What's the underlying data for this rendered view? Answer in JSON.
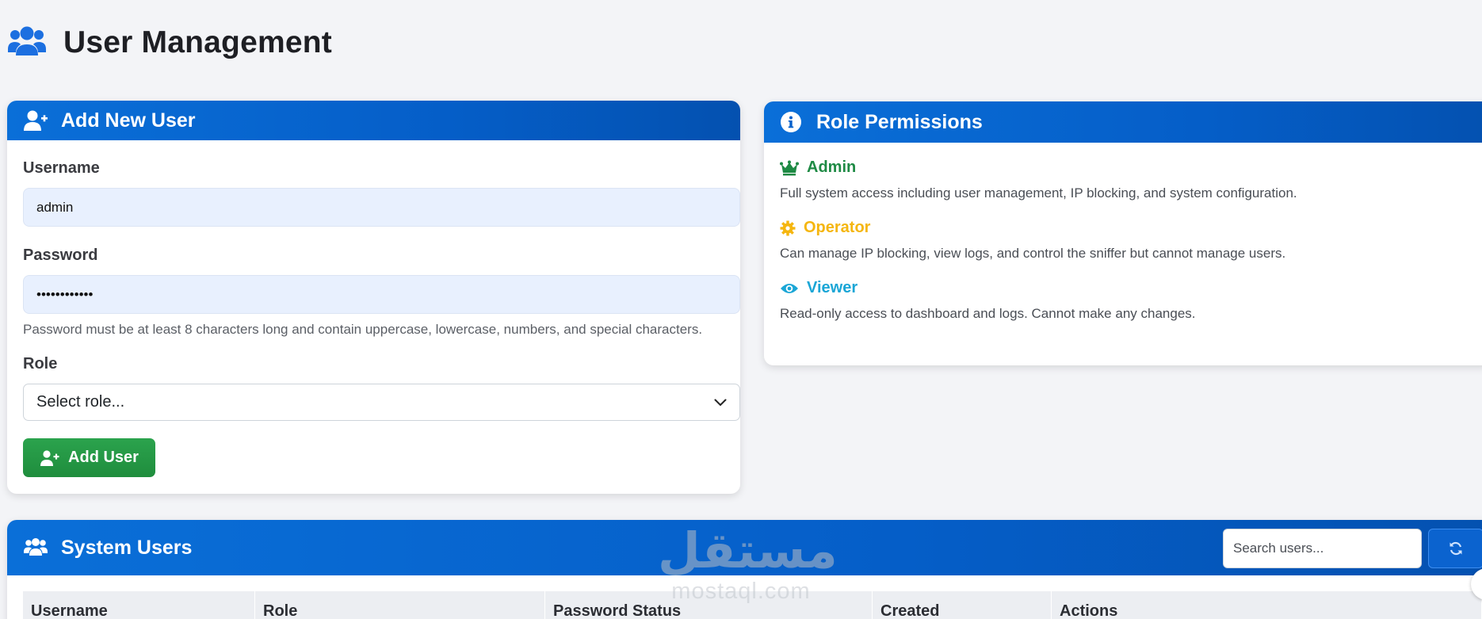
{
  "page": {
    "title": "User Management",
    "accent_color": "#0b63cf"
  },
  "add_user": {
    "header_title": "Add New User",
    "username_label": "Username",
    "username_value": "admin",
    "password_label": "Password",
    "password_value": "••••••••••••",
    "password_help": "Password must be at least 8 characters long and contain uppercase, lowercase, numbers, and special characters.",
    "role_label": "Role",
    "role_selected": "Select role...",
    "submit_label": "Add User",
    "submit_color": "#22963f"
  },
  "role_permissions": {
    "header_title": "Role Permissions",
    "roles": [
      {
        "name": "Admin",
        "icon": "crown-icon",
        "color": "#1e8a44",
        "description": "Full system access including user management, IP blocking, and system configuration."
      },
      {
        "name": "Operator",
        "icon": "cog-icon",
        "color": "#f5b60f",
        "description": "Can manage IP blocking, view logs, and control the sniffer but cannot manage users."
      },
      {
        "name": "Viewer",
        "icon": "eye-icon",
        "color": "#1aa6d6",
        "description": "Read-only access to dashboard and logs. Cannot make any changes."
      }
    ]
  },
  "system_users": {
    "header_title": "System Users",
    "search_placeholder": "Search users...",
    "refresh_icon": "refresh-icon",
    "columns": [
      "Username",
      "Role",
      "Password Status",
      "Created",
      "Actions"
    ]
  },
  "watermark": {
    "arabic": "مستقل",
    "latin": "mostaql.com"
  }
}
